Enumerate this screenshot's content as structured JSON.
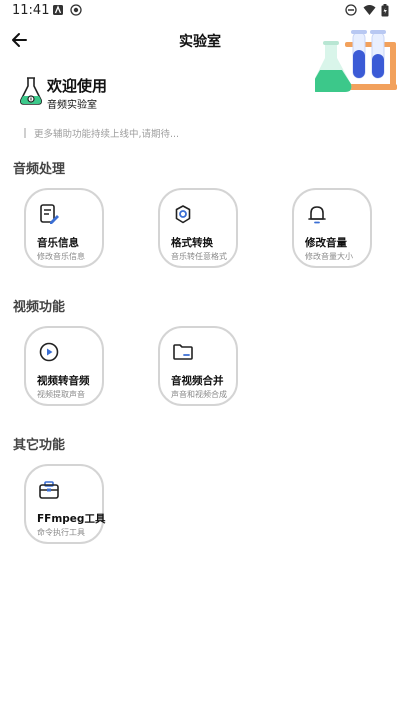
{
  "status_bar": {
    "time": "11:41"
  },
  "app_bar": {
    "title": "实验室"
  },
  "welcome": {
    "title": "欢迎使用",
    "subtitle": "音频实验室"
  },
  "notice": {
    "text": "更多辅助功能持续上线中,请期待..."
  },
  "sections": [
    {
      "title": "音频处理",
      "cards": [
        {
          "title": "音乐信息",
          "subtitle": "修改音乐信息",
          "icon": "music-info-icon"
        },
        {
          "title": "格式转换",
          "subtitle": "音乐转任意格式",
          "icon": "gear-icon"
        },
        {
          "title": "修改音量",
          "subtitle": "修改音量大小",
          "icon": "bell-icon"
        }
      ]
    },
    {
      "title": "视频功能",
      "cards": [
        {
          "title": "视频转音频",
          "subtitle": "视频提取声音",
          "icon": "play-circle-icon"
        },
        {
          "title": "音视频合并",
          "subtitle": "声音和视频合成",
          "icon": "folder-icon"
        }
      ]
    },
    {
      "title": "其它功能",
      "cards": [
        {
          "title": "FFmpeg工具",
          "subtitle": "命令执行工具",
          "icon": "toolbox-icon"
        }
      ]
    }
  ],
  "colors": {
    "accent_blue": "#3b6fd4",
    "card_border": "#d4d4d4",
    "green": "#3cc88a",
    "orange": "#f2a15c"
  }
}
